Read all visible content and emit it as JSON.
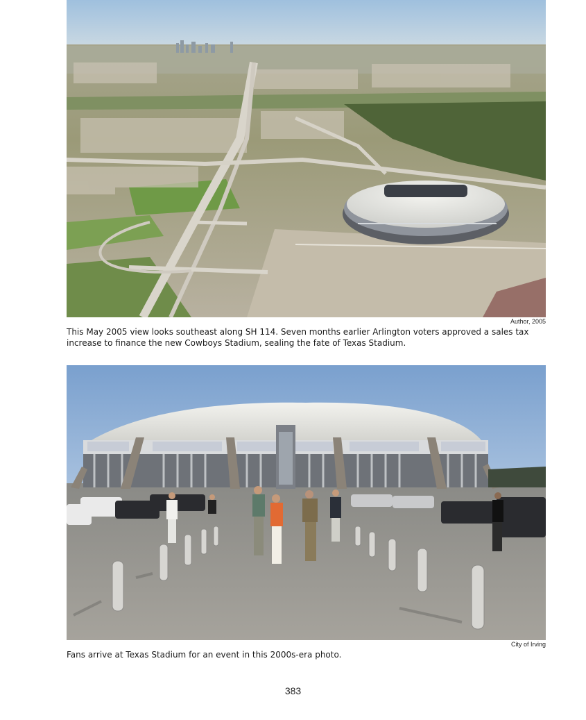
{
  "figures": [
    {
      "image_alt": "Aerial view of Texas Stadium and SH 114 interchange with Dallas skyline in distance",
      "credit": "Author, 2005",
      "caption": "This May 2005 view looks southeast along SH 114. Seven months earlier Arlington voters approved a sales tax increase to finance the new Cowboys Stadium, sealing the fate of Texas Stadium."
    },
    {
      "image_alt": "Fans walking across parking lot toward Texas Stadium",
      "credit": "City of Irving",
      "caption": "Fans arrive at Texas Stadium for an event in this 2000s-era photo."
    }
  ],
  "page_number": "383"
}
